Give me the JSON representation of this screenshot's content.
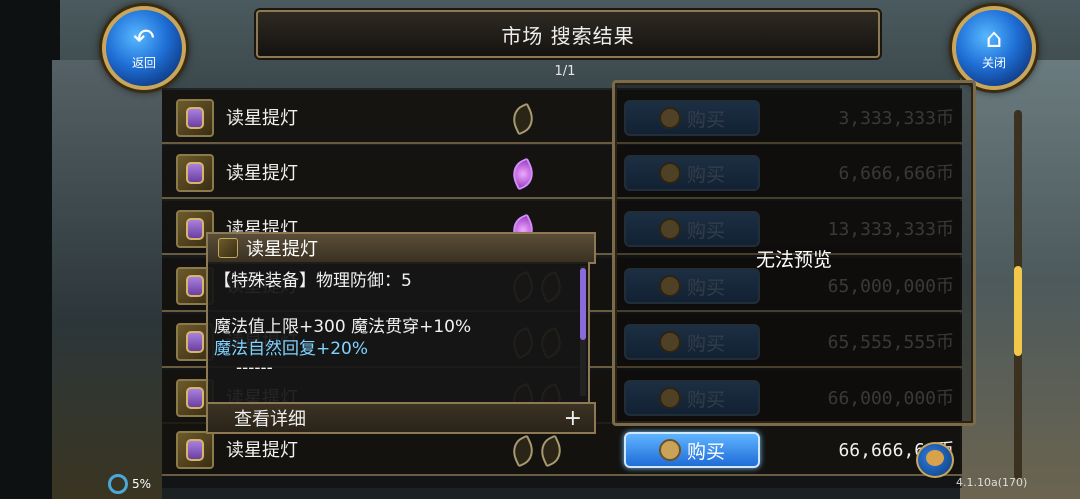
{
  "header": {
    "title": "市场  搜索结果",
    "page_indicator": "1/1"
  },
  "buttons": {
    "back_label": "返回",
    "close_label": "关闭"
  },
  "rows": [
    {
      "name": "读星提灯",
      "leaves": [
        "plain"
      ],
      "buy_label": "购买",
      "price": "3,333,333币",
      "active": false
    },
    {
      "name": "读星提灯",
      "leaves": [
        "purple"
      ],
      "buy_label": "购买",
      "price": "6,666,666币",
      "active": false
    },
    {
      "name": "读星提灯",
      "leaves": [
        "purple"
      ],
      "buy_label": "购买",
      "price": "13,333,333币",
      "active": false
    },
    {
      "name": "读星提灯",
      "leaves": [
        "plain",
        "plain"
      ],
      "buy_label": "购买",
      "price": "65,000,000币",
      "active": false
    },
    {
      "name": "读星提灯",
      "leaves": [
        "plain",
        "plain"
      ],
      "buy_label": "购买",
      "price": "65,555,555币",
      "active": false
    },
    {
      "name": "读星提灯",
      "leaves": [
        "plain",
        "plain"
      ],
      "buy_label": "购买",
      "price": "66,000,000币",
      "active": false
    },
    {
      "name": "读星提灯",
      "leaves": [
        "plain",
        "plain"
      ],
      "buy_label": "购买",
      "price": "66,666,66币",
      "active": true
    }
  ],
  "preview": {
    "message": "无法预览"
  },
  "tooltip": {
    "title": "读星提灯",
    "line1": "【特殊装备】物理防御：5",
    "line2": "魔法值上限+300 魔法贯穿+10%",
    "line3": "魔法自然回复+20%",
    "line4": "------",
    "details_label": "查看详细",
    "plus": "+"
  },
  "status": {
    "battery": "5%",
    "version": "4.1.10a(170)"
  }
}
